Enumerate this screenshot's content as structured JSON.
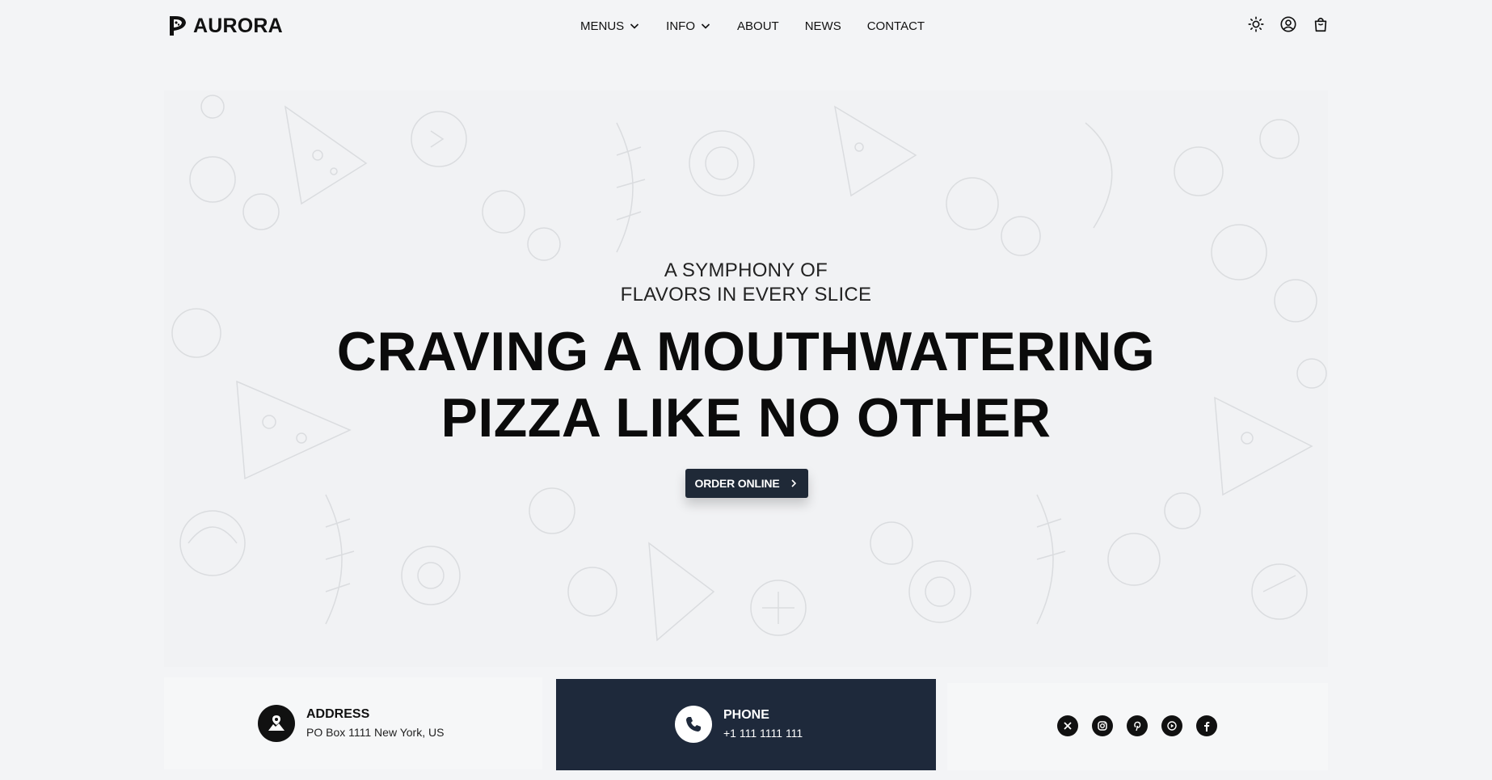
{
  "brand": {
    "name": "AURORA"
  },
  "nav": {
    "items": [
      {
        "label": "MENUS",
        "dropdown": true
      },
      {
        "label": "INFO",
        "dropdown": true
      },
      {
        "label": "ABOUT",
        "dropdown": false
      },
      {
        "label": "NEWS",
        "dropdown": false
      },
      {
        "label": "CONTACT",
        "dropdown": false
      }
    ]
  },
  "header_icons": [
    "sun-icon",
    "user-icon",
    "shopping-bag-icon"
  ],
  "hero": {
    "kicker_line1": "A SYMPHONY OF",
    "kicker_line2": "FLAVORS IN EVERY SLICE",
    "headline_line1": "CRAVING A MOUTHWATERING",
    "headline_line2": "PIZZA LIKE NO OTHER",
    "cta_label": "ORDER ONLINE"
  },
  "info": {
    "address": {
      "title": "ADDRESS",
      "value": "PO Box 1111 New York, US"
    },
    "phone": {
      "title": "PHONE",
      "value": "+1 111 1111 111"
    },
    "socials": [
      "x-icon",
      "instagram-icon",
      "pinterest-icon",
      "youtube-icon",
      "facebook-icon"
    ]
  },
  "colors": {
    "page_bg": "#f3f4f6",
    "accent_dark": "#1e293b",
    "text": "#111111"
  }
}
